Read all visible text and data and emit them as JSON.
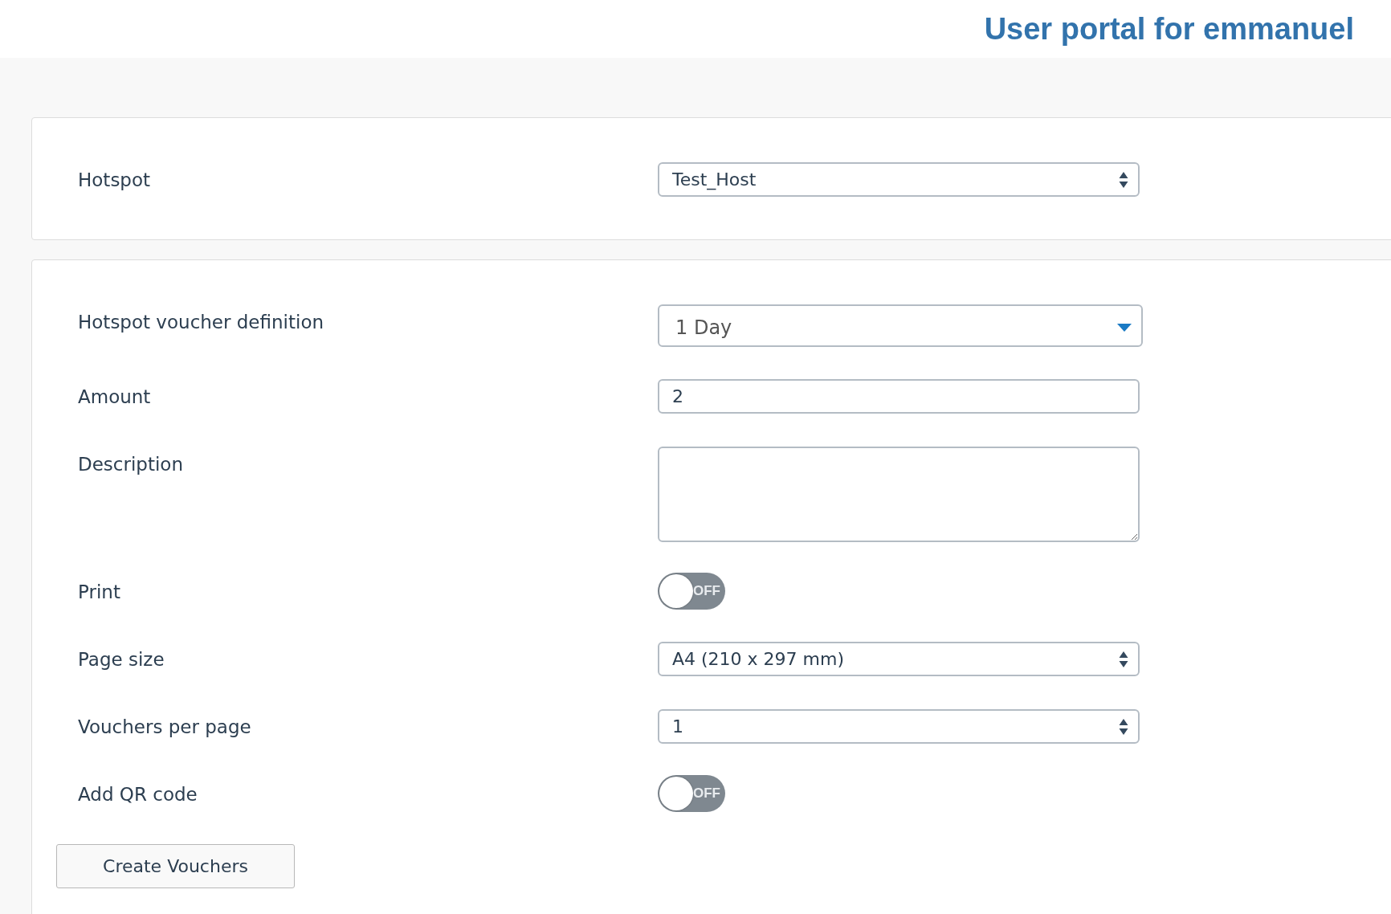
{
  "header": {
    "title": "User portal for emmanuel"
  },
  "panels": [
    {
      "fields": [
        {
          "kind": "select",
          "label": "Hotspot",
          "value": "Test_Host"
        }
      ]
    },
    {
      "fields": [
        {
          "kind": "dropdown",
          "label": "Hotspot voucher definition",
          "value": "1 Day"
        },
        {
          "kind": "text",
          "label": "Amount",
          "value": "2"
        },
        {
          "kind": "textarea",
          "label": "Description"
        },
        {
          "kind": "toggle",
          "label": "Print",
          "on": false,
          "text": "OFF"
        },
        {
          "kind": "select",
          "label": "Page size",
          "value": "A4 (210 x 297 mm)"
        },
        {
          "kind": "select",
          "label": "Vouchers per page",
          "value": "1"
        },
        {
          "kind": "toggle",
          "label": "Add QR code",
          "on": false,
          "text": "OFF"
        }
      ],
      "button": "Create Vouchers"
    }
  ]
}
